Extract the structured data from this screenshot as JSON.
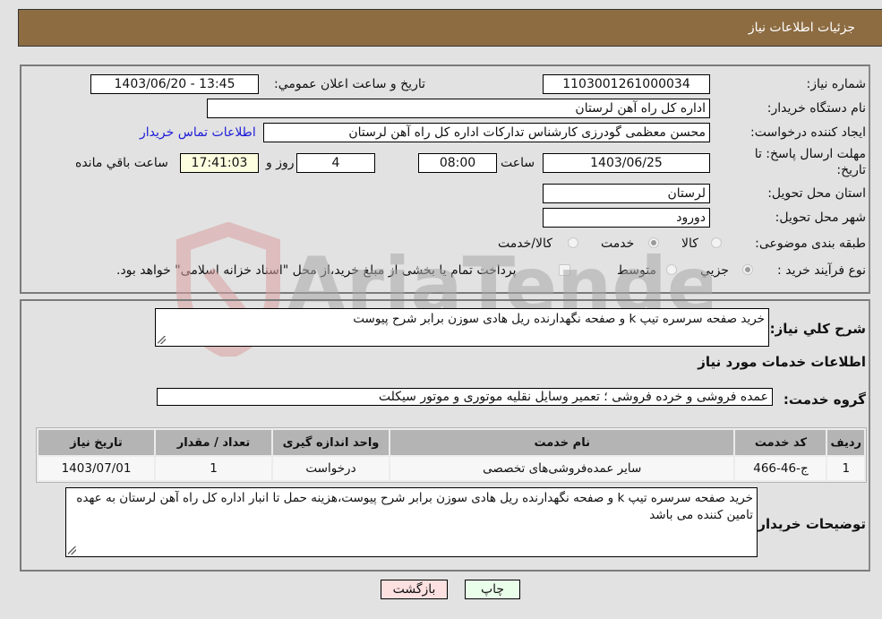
{
  "header": {
    "title": "جزئیات اطلاعات نیاز"
  },
  "details": {
    "need_number_label": "شماره نياز:",
    "need_number": "1103001261000034",
    "announce_label": "تاريخ و ساعت اعلان عمومي:",
    "announce_value": "1403/06/20 - 13:45",
    "buyer_org_label": "نام دستگاه خريدار:",
    "buyer_org": "اداره کل راه آهن لرستان",
    "creator_label": "ايجاد کننده درخواست:",
    "creator": "محسن معظمی گودرزی کارشناس تدارکات اداره کل راه آهن لرستان",
    "contact_link": "اطلاعات تماس خريدار",
    "deadline_label_1": "مهلت ارسال پاسخ: تا",
    "deadline_label_2": "تاريخ:",
    "deadline_date": "1403/06/25",
    "time_label": "ساعت",
    "deadline_time": "08:00",
    "days_value": "4",
    "days_label": "روز و",
    "remaining_time": "17:41:03",
    "remaining_label": "ساعت باقي مانده",
    "province_label": "استان محل تحويل:",
    "province": "لرستان",
    "city_label": "شهر محل تحويل:",
    "city": "دورود",
    "category_label": "طبقه بندی موضوعی:",
    "category_options": [
      {
        "label": "کالا",
        "selected": false
      },
      {
        "label": "خدمت",
        "selected": true
      },
      {
        "label": "کالا/خدمت",
        "selected": false
      }
    ],
    "process_label": "نوع فرآيند خريد :",
    "process_options": [
      {
        "label": "جزيي",
        "selected": true
      },
      {
        "label": "متوسط",
        "selected": false
      }
    ],
    "payment_note": "پرداخت تمام يا بخشی از مبلغ خريد،از محل \"اسناد خزانه اسلامی\" خواهد بود.",
    "payment_checked": false
  },
  "summary": {
    "description_label": "شرح کلي نياز:",
    "description": "خريد صفحه سرسره تيپ k و صفحه نگهدارنده ريل هادی سوزن برابر شرح پيوست",
    "services_title": "اطلاعات خدمات مورد نياز",
    "service_group_label": "گروه خدمت:",
    "service_group": "عمده فروشی و خرده فروشی ؛ تعمير وسايل نقليه موتوری و موتور سيکلت"
  },
  "table": {
    "headers": [
      "رديف",
      "کد خدمت",
      "نام خدمت",
      "واحد اندازه گيری",
      "تعداد / مقدار",
      "تاريخ نياز"
    ],
    "rows": [
      [
        "1",
        "ج-46-466",
        "ساير عمده‌فروشی‌های تخصصی",
        "درخواست",
        "1",
        "1403/07/01"
      ]
    ]
  },
  "buyer_notes": {
    "label": "توضيحات خريدار:",
    "text": "خريد صفحه سرسره تيپ k و صفحه نگهدارنده ريل هادی سوزن برابر شرح پيوست،هزينه حمل تا انبار اداره کل راه آهن لرستان به عهده تامين کننده می باشد"
  },
  "buttons": {
    "print": "چاپ",
    "back": "بازگشت"
  },
  "watermark": {
    "text": "AriaTender.neT",
    "colors": {
      "shield": "#d9a0a0",
      "text": "#a8a8a8"
    }
  }
}
